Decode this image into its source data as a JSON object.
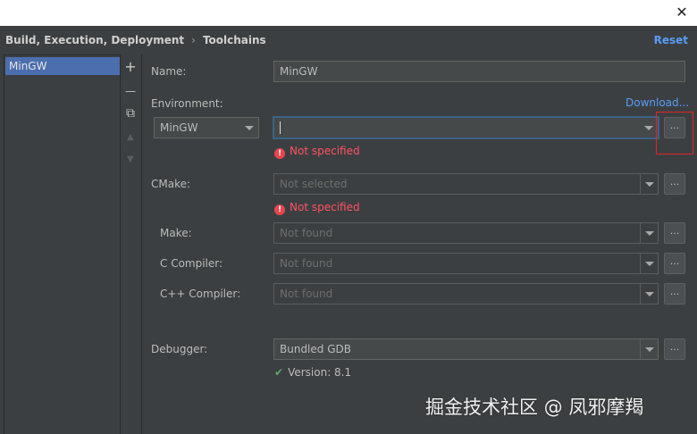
{
  "window": {
    "close_glyph": "✕"
  },
  "header": {
    "breadcrumb_parent": "Build, Execution, Deployment",
    "breadcrumb_sep": "›",
    "breadcrumb_current": "Toolchains",
    "reset_label": "Reset"
  },
  "toolchains": {
    "items": [
      {
        "label": "MinGW",
        "selected": true
      }
    ]
  },
  "toolbar": {
    "add": "+",
    "remove": "—",
    "copy": "⧉",
    "up": "▲",
    "down": "▼"
  },
  "form": {
    "name_label": "Name:",
    "name_value": "MinGW",
    "environment_label": "Environment:",
    "download_link": "Download...",
    "environment_type": "MinGW",
    "environment_path": "",
    "environment_error": "Not specified",
    "cmake_label": "CMake:",
    "cmake_value": "Not selected",
    "cmake_error": "Not specified",
    "make_label": "Make:",
    "make_value": "Not found",
    "c_compiler_label": "C Compiler:",
    "c_compiler_value": "Not found",
    "cpp_compiler_label": "C++ Compiler:",
    "cpp_compiler_value": "Not found",
    "debugger_label": "Debugger:",
    "debugger_value": "Bundled GDB",
    "debugger_version": "Version: 8.1",
    "browse_glyph": "..."
  },
  "icons": {
    "error": "!",
    "check": "✔"
  },
  "watermark": "掘金技术社区 @ 凤邪摩羯",
  "colors": {
    "accent": "#589df6",
    "selection": "#4b6eaf",
    "error": "#ff5261",
    "ok": "#59a869",
    "highlight": "#e0252b"
  }
}
